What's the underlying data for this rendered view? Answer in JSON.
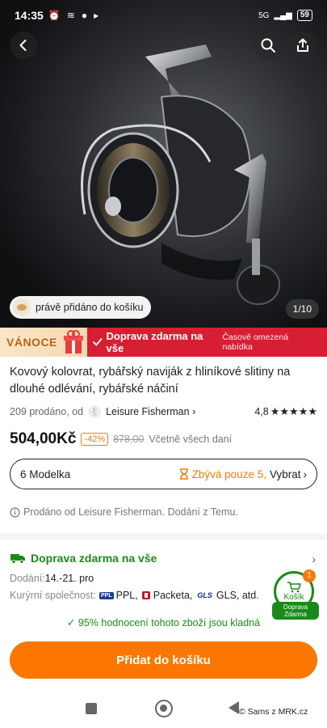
{
  "status_bar": {
    "time": "14:35",
    "network": "5G",
    "battery": "59"
  },
  "gallery": {
    "added_to_cart_text": "právě přidáno do košíku",
    "counter": "1/10",
    "image_description_icon": "fishing-reel"
  },
  "promo": {
    "xmas_label": "VÁNOCE",
    "free_shipping": "Doprava zdarma na vše",
    "limited_offer": "Časově omezená nabídka"
  },
  "product": {
    "title": "Kovový kolovrat, rybářský naviják z hliníkové slitiny na dlouhé odlévání, rybářské náčiní",
    "sold_by_prefix": "209 prodáno, od",
    "store_name": "Leisure Fisherman",
    "rating": "4,8",
    "stars": "★★★★★",
    "price": "504,00Kč",
    "discount": "-42%",
    "old_price": "878,00",
    "tax_note": "Včetně všech daní",
    "variant_label": "6 Modelka",
    "stock_warning": "Zbývá pouze 5,",
    "choose_label": "Vybrat",
    "sold_by_note": "Prodáno od Leisure Fisherman. Dodání z Temu."
  },
  "shipping": {
    "title": "Doprava zdarma na vše",
    "delivery_label": "Dodání:",
    "delivery_value": "14.-21. pro",
    "carriers_label": "Kurýrní společnost:",
    "carrier_1": "PPL,",
    "carrier_2": "Packeta,",
    "carrier_3": "GLS, atd.",
    "carrier_1_tag": "PPL",
    "carrier_3_tag": "GLS",
    "quality_note": "95% hodnocení tohoto zboží jsou kladná"
  },
  "cart_badge": {
    "count": "1",
    "label": "Košík",
    "free_line1": "Doprava",
    "free_line2": "Zdarma"
  },
  "cta": {
    "add_to_cart": "Přidat do košíku"
  },
  "watermark": "© Sams z MRK.cz",
  "colors": {
    "accent": "#fb7701",
    "promo_red": "#d71e32",
    "green": "#1a8a1a"
  }
}
